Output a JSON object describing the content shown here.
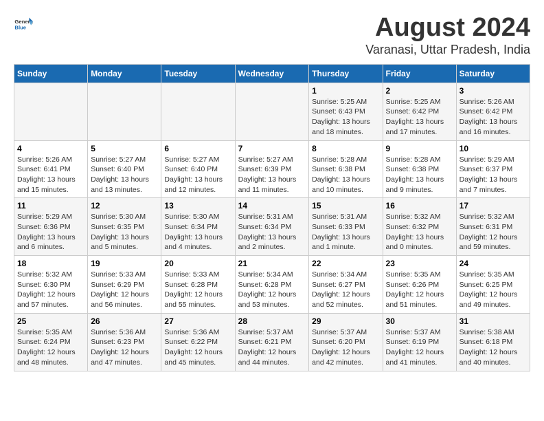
{
  "logo": {
    "general": "General",
    "blue": "Blue"
  },
  "title": "August 2024",
  "subtitle": "Varanasi, Uttar Pradesh, India",
  "days_of_week": [
    "Sunday",
    "Monday",
    "Tuesday",
    "Wednesday",
    "Thursday",
    "Friday",
    "Saturday"
  ],
  "weeks": [
    [
      {
        "day": "",
        "info": ""
      },
      {
        "day": "",
        "info": ""
      },
      {
        "day": "",
        "info": ""
      },
      {
        "day": "",
        "info": ""
      },
      {
        "day": "1",
        "info": "Sunrise: 5:25 AM\nSunset: 6:43 PM\nDaylight: 13 hours and 18 minutes."
      },
      {
        "day": "2",
        "info": "Sunrise: 5:25 AM\nSunset: 6:42 PM\nDaylight: 13 hours and 17 minutes."
      },
      {
        "day": "3",
        "info": "Sunrise: 5:26 AM\nSunset: 6:42 PM\nDaylight: 13 hours and 16 minutes."
      }
    ],
    [
      {
        "day": "4",
        "info": "Sunrise: 5:26 AM\nSunset: 6:41 PM\nDaylight: 13 hours and 15 minutes."
      },
      {
        "day": "5",
        "info": "Sunrise: 5:27 AM\nSunset: 6:40 PM\nDaylight: 13 hours and 13 minutes."
      },
      {
        "day": "6",
        "info": "Sunrise: 5:27 AM\nSunset: 6:40 PM\nDaylight: 13 hours and 12 minutes."
      },
      {
        "day": "7",
        "info": "Sunrise: 5:27 AM\nSunset: 6:39 PM\nDaylight: 13 hours and 11 minutes."
      },
      {
        "day": "8",
        "info": "Sunrise: 5:28 AM\nSunset: 6:38 PM\nDaylight: 13 hours and 10 minutes."
      },
      {
        "day": "9",
        "info": "Sunrise: 5:28 AM\nSunset: 6:38 PM\nDaylight: 13 hours and 9 minutes."
      },
      {
        "day": "10",
        "info": "Sunrise: 5:29 AM\nSunset: 6:37 PM\nDaylight: 13 hours and 7 minutes."
      }
    ],
    [
      {
        "day": "11",
        "info": "Sunrise: 5:29 AM\nSunset: 6:36 PM\nDaylight: 13 hours and 6 minutes."
      },
      {
        "day": "12",
        "info": "Sunrise: 5:30 AM\nSunset: 6:35 PM\nDaylight: 13 hours and 5 minutes."
      },
      {
        "day": "13",
        "info": "Sunrise: 5:30 AM\nSunset: 6:34 PM\nDaylight: 13 hours and 4 minutes."
      },
      {
        "day": "14",
        "info": "Sunrise: 5:31 AM\nSunset: 6:34 PM\nDaylight: 13 hours and 2 minutes."
      },
      {
        "day": "15",
        "info": "Sunrise: 5:31 AM\nSunset: 6:33 PM\nDaylight: 13 hours and 1 minute."
      },
      {
        "day": "16",
        "info": "Sunrise: 5:32 AM\nSunset: 6:32 PM\nDaylight: 13 hours and 0 minutes."
      },
      {
        "day": "17",
        "info": "Sunrise: 5:32 AM\nSunset: 6:31 PM\nDaylight: 12 hours and 59 minutes."
      }
    ],
    [
      {
        "day": "18",
        "info": "Sunrise: 5:32 AM\nSunset: 6:30 PM\nDaylight: 12 hours and 57 minutes."
      },
      {
        "day": "19",
        "info": "Sunrise: 5:33 AM\nSunset: 6:29 PM\nDaylight: 12 hours and 56 minutes."
      },
      {
        "day": "20",
        "info": "Sunrise: 5:33 AM\nSunset: 6:28 PM\nDaylight: 12 hours and 55 minutes."
      },
      {
        "day": "21",
        "info": "Sunrise: 5:34 AM\nSunset: 6:28 PM\nDaylight: 12 hours and 53 minutes."
      },
      {
        "day": "22",
        "info": "Sunrise: 5:34 AM\nSunset: 6:27 PM\nDaylight: 12 hours and 52 minutes."
      },
      {
        "day": "23",
        "info": "Sunrise: 5:35 AM\nSunset: 6:26 PM\nDaylight: 12 hours and 51 minutes."
      },
      {
        "day": "24",
        "info": "Sunrise: 5:35 AM\nSunset: 6:25 PM\nDaylight: 12 hours and 49 minutes."
      }
    ],
    [
      {
        "day": "25",
        "info": "Sunrise: 5:35 AM\nSunset: 6:24 PM\nDaylight: 12 hours and 48 minutes."
      },
      {
        "day": "26",
        "info": "Sunrise: 5:36 AM\nSunset: 6:23 PM\nDaylight: 12 hours and 47 minutes."
      },
      {
        "day": "27",
        "info": "Sunrise: 5:36 AM\nSunset: 6:22 PM\nDaylight: 12 hours and 45 minutes."
      },
      {
        "day": "28",
        "info": "Sunrise: 5:37 AM\nSunset: 6:21 PM\nDaylight: 12 hours and 44 minutes."
      },
      {
        "day": "29",
        "info": "Sunrise: 5:37 AM\nSunset: 6:20 PM\nDaylight: 12 hours and 42 minutes."
      },
      {
        "day": "30",
        "info": "Sunrise: 5:37 AM\nSunset: 6:19 PM\nDaylight: 12 hours and 41 minutes."
      },
      {
        "day": "31",
        "info": "Sunrise: 5:38 AM\nSunset: 6:18 PM\nDaylight: 12 hours and 40 minutes."
      }
    ]
  ]
}
